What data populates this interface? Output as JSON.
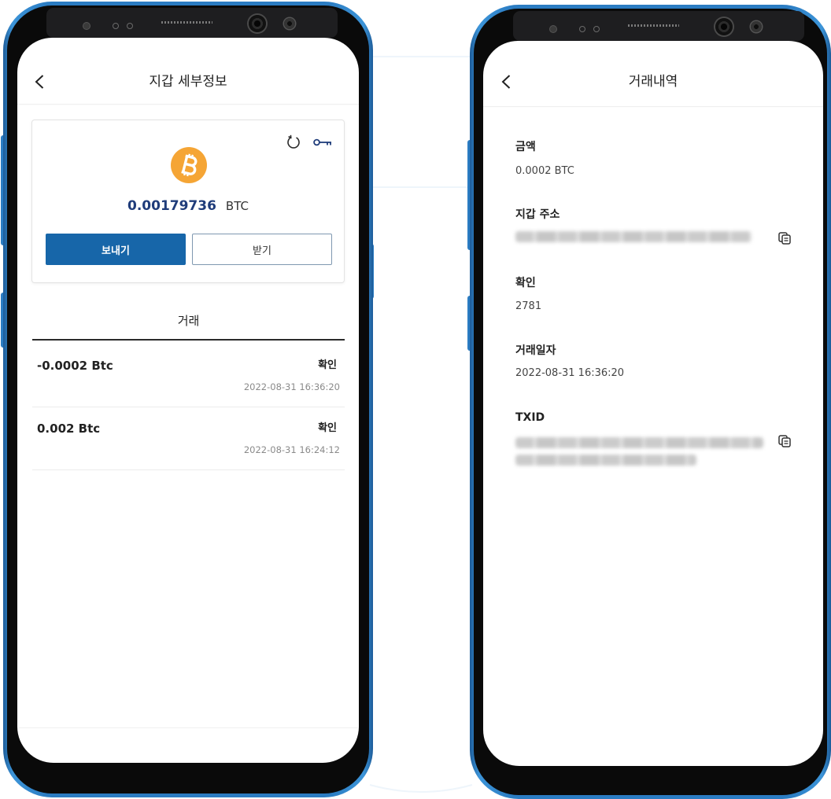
{
  "colors": {
    "frame_blue": "#2b7cc2",
    "brand_blue": "#1766a9",
    "balance_navy": "#1f3c7a",
    "bitcoin_orange": "#f5a535",
    "text_primary": "#222222",
    "text_secondary": "#8a8a8a"
  },
  "wallet_detail_screen": {
    "header": {
      "back_icon": "chevron-left-icon",
      "title": "지갑 세부정보"
    },
    "wallet_card": {
      "refresh_icon": "refresh-icon",
      "key_icon": "key-icon",
      "coin_icon": "bitcoin-icon",
      "balance": "0.00179736",
      "unit": "BTC",
      "send_label": "보내기",
      "receive_label": "받기"
    },
    "tabs": [
      {
        "label": "거래",
        "active": true
      }
    ],
    "transactions": [
      {
        "amount": "-0.0002 Btc",
        "status": "확인",
        "datetime": "2022-08-31 16:36:20"
      },
      {
        "amount": "0.002 Btc",
        "status": "확인",
        "datetime": "2022-08-31 16:24:12"
      }
    ]
  },
  "transaction_detail_screen": {
    "header": {
      "back_icon": "chevron-left-icon",
      "title": "거래내역"
    },
    "fields": [
      {
        "label": "금액",
        "value": "0.0002 BTC"
      },
      {
        "label": "지갑 주소",
        "copy_icon": "copy-icon"
      },
      {
        "label": "확인",
        "value": "2781"
      },
      {
        "label": "거래일자",
        "value": "2022-08-31 16:36:20"
      },
      {
        "label": "TXID",
        "copy_icon": "copy-icon"
      }
    ]
  }
}
